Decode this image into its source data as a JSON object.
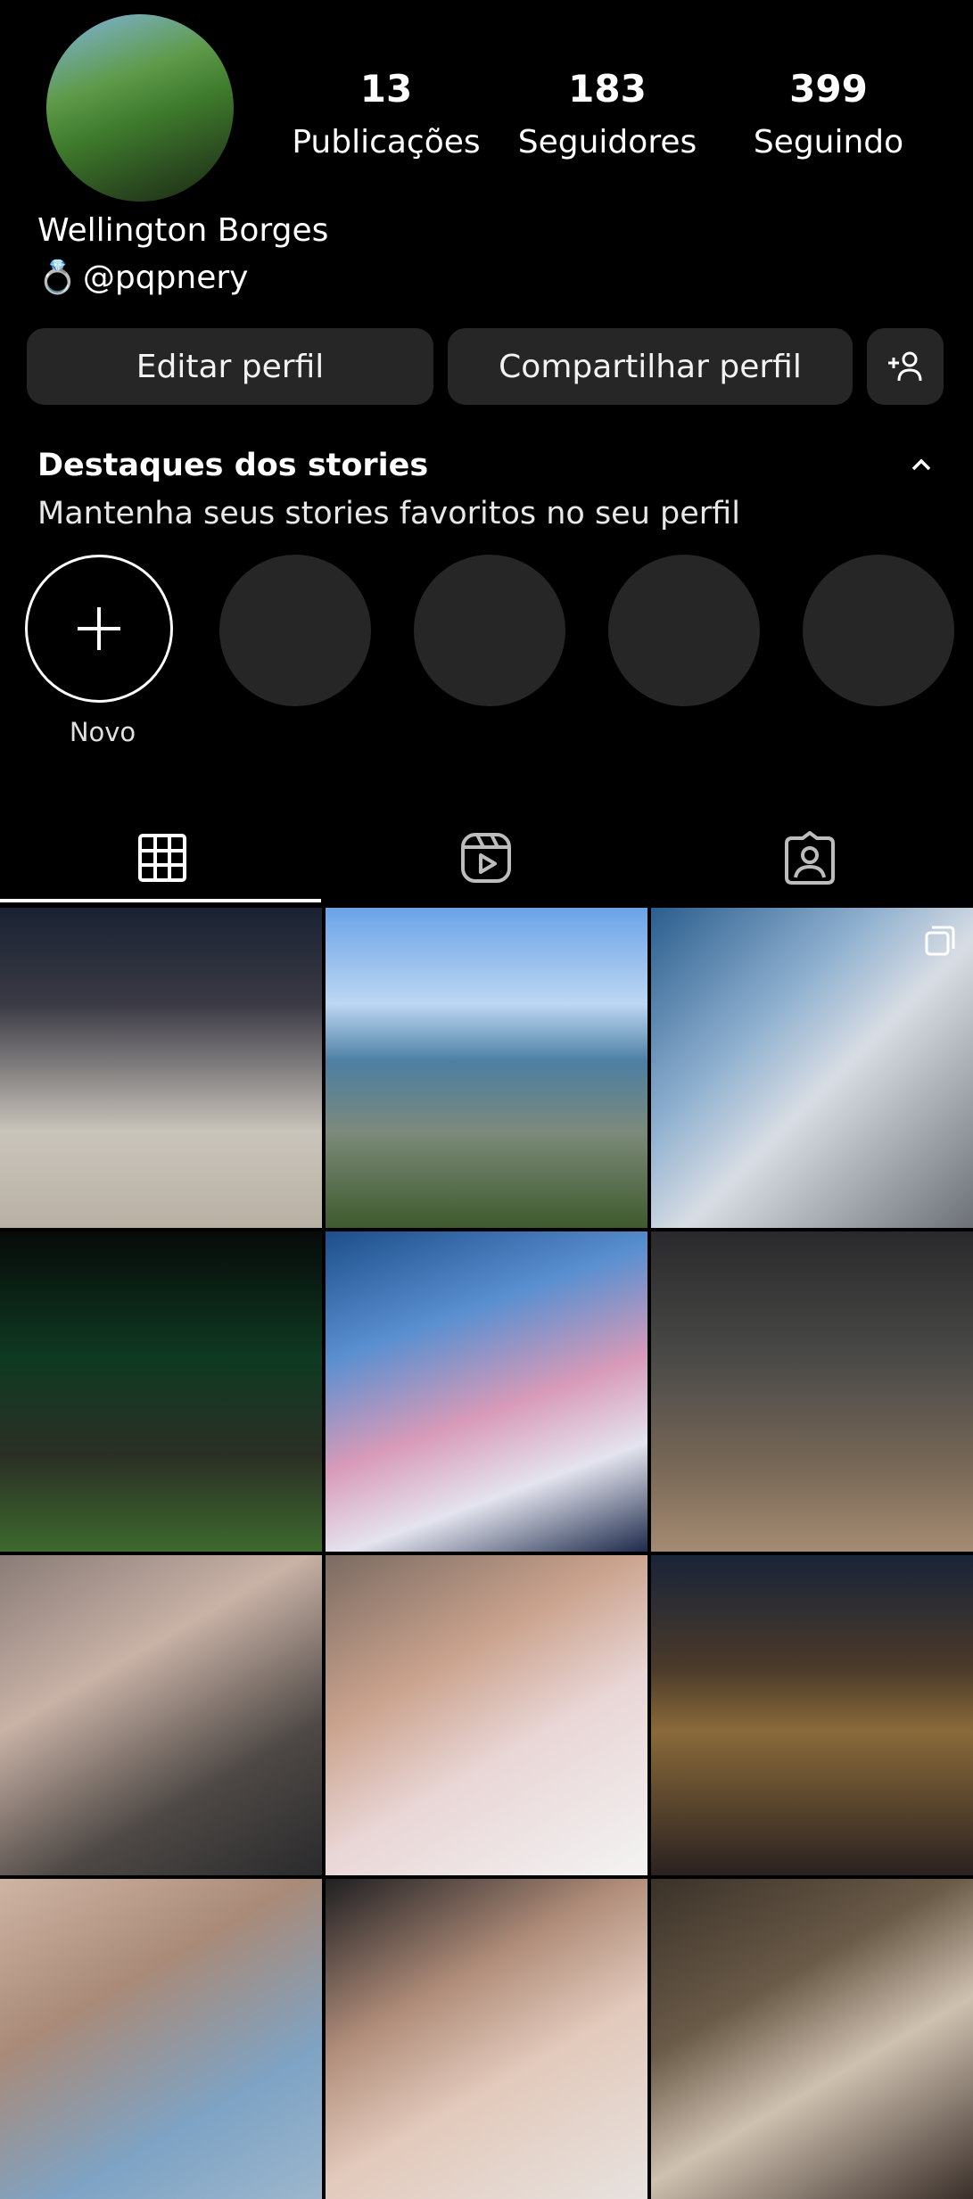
{
  "profile": {
    "name": "Wellington Borges",
    "handle": "@pqpnery",
    "handle_emoji": "💍",
    "stats": [
      {
        "value": "13",
        "label": "Publicações"
      },
      {
        "value": "183",
        "label": "Seguidores"
      },
      {
        "value": "399",
        "label": "Seguindo"
      }
    ]
  },
  "buttons": {
    "edit": "Editar perfil",
    "share": "Compartilhar perfil"
  },
  "highlights": {
    "title": "Destaques dos stories",
    "subtitle": "Mantenha seus stories favoritos no seu perfil",
    "new_label": "Novo"
  },
  "tabs": [
    "grid-icon",
    "reels-icon",
    "tagged-icon"
  ],
  "posts": [
    {
      "bg": "linear-gradient(180deg,#1a2233 0%,#3b3a44 30%,#c9c4bb 70%,#b8b0a3 100%)",
      "multi": false
    },
    {
      "bg": "linear-gradient(180deg,#6aa3e8 0%,#bcd7f2 30%,#4c7fa3 48%,#7c8a7a 70%,#3f5a2e 100%)",
      "multi": false
    },
    {
      "bg": "linear-gradient(135deg,#2b5e8e 0%,#8fb0cf 35%,#d8dde4 55%,#6c7077 100%)",
      "multi": true
    },
    {
      "bg": "linear-gradient(180deg,#070b0a 0%,#0f3a22 40%,#2b2f25 70%,#3d6a2e 100%)",
      "multi": false
    },
    {
      "bg": "linear-gradient(160deg,#1c4e8a 0%,#5a8fd0 30%,#d89ab8 55%,#e4e4ee 75%,#1d2a4a 100%)",
      "multi": false
    },
    {
      "bg": "linear-gradient(180deg,#2a2a2c 0%,#4a4a48 40%,#7a6a58 75%,#a48b72 100%)",
      "multi": false
    },
    {
      "bg": "linear-gradient(150deg,#8a7c78 0%,#c9b2a6 35%,#4d4845 70%,#2a2a2c 100%)",
      "multi": false
    },
    {
      "bg": "linear-gradient(150deg,#7b6b62 0%,#caa38e 35%,#e9d6d6 60%,#f3f3f3 100%)",
      "multi": false
    },
    {
      "bg": "linear-gradient(180deg,#1a2438 0%,#4a3a2a 35%,#8a6a3a 55%,#2a2220 100%)",
      "multi": false
    },
    {
      "bg": "linear-gradient(150deg,#cfb4a3 0%,#a98a78 35%,#7ea3c4 70%,#9cb6cc 100%)",
      "multi": false
    },
    {
      "bg": "linear-gradient(150deg,#1f1f22 0%,#b08d7a 35%,#e2c9bb 60%,#e7e2df 100%)",
      "multi": false
    },
    {
      "bg": "linear-gradient(150deg,#3a3228 0%,#6a5a48 35%,#cfc1b0 60%,#3a2f2a 100%)",
      "multi": false
    }
  ],
  "colors": {
    "background": "#000000",
    "button": "#262626",
    "text": "#ffffff"
  }
}
